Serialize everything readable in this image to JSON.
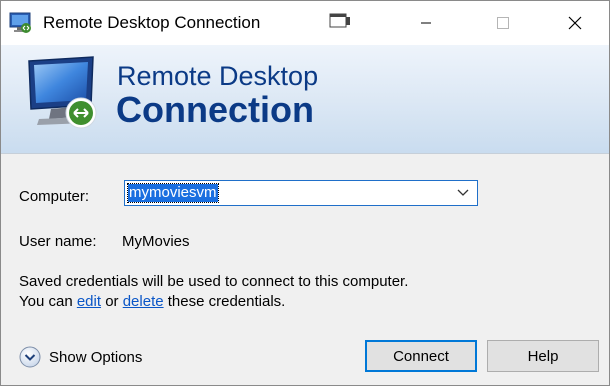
{
  "window": {
    "title": "Remote Desktop Connection"
  },
  "banner": {
    "line1": "Remote Desktop",
    "line2": "Connection"
  },
  "form": {
    "computer_label": "Computer:",
    "computer_value": "mymoviesvm",
    "user_label": "User name:",
    "user_value": "MyMovies",
    "credentials_line1": "Saved credentials will be used to connect to this computer.",
    "credentials_prefix": "You can ",
    "edit_link": "edit",
    "or_text": " or ",
    "delete_link": "delete",
    "credentials_suffix": " these credentials."
  },
  "footer": {
    "show_options": "Show Options",
    "connect": "Connect",
    "help": "Help"
  },
  "colors": {
    "banner_text": "#0b3a86",
    "selection": "#1a6fe0",
    "link": "#0a56c7",
    "default_button_border": "#0078d7"
  }
}
